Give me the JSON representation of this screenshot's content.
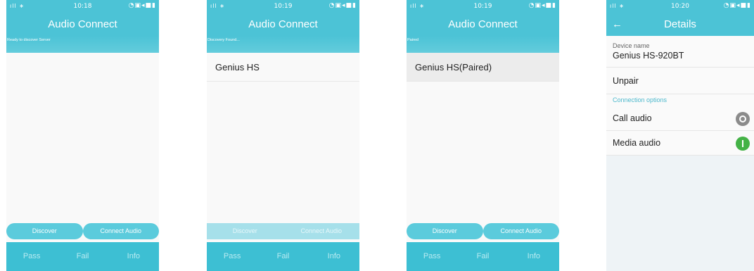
{
  "screens": [
    {
      "status": {
        "left": "ıll ∗",
        "time": "10:18",
        "right": "◔▣◂■▮"
      },
      "title": "Audio Connect",
      "subtitle": "Ready to discover Server",
      "items": [],
      "buttons": {
        "discover": "Discover",
        "connect": "Connect Audio"
      },
      "footer": {
        "pass": "Pass",
        "fail": "Fail",
        "info": "Info"
      }
    },
    {
      "status": {
        "left": "ıll ∗",
        "time": "10:19",
        "right": "◔▣◂■▮"
      },
      "title": "Audio Connect",
      "subtitle": "Discovery Found...",
      "items": [
        "Genius HS"
      ],
      "buttons": {
        "discover": "Discover",
        "connect": "Connect Audio"
      },
      "footer": {
        "pass": "Pass",
        "fail": "Fail",
        "info": "Info"
      }
    },
    {
      "status": {
        "left": "ıll ∗",
        "time": "10:19",
        "right": "◔▣◂■▮"
      },
      "title": "Audio Connect",
      "subtitle": "Paired",
      "items": [
        "Genius HS(Paired)"
      ],
      "buttons": {
        "discover": "Discover",
        "connect": "Connect Audio"
      },
      "footer": {
        "pass": "Pass",
        "fail": "Fail",
        "info": "Info"
      }
    }
  ],
  "details": {
    "status": {
      "left": "ıll ∗",
      "time": "10:20",
      "right": "◔▣◂■▮"
    },
    "back_icon": "←",
    "title": "Details",
    "device_name_label": "Device name",
    "device_name": "Genius HS-920BT",
    "unpair": "Unpair",
    "section": "Connection options",
    "call_audio": "Call audio",
    "call_audio_on": false,
    "media_audio": "Media audio",
    "media_audio_on": true
  },
  "colors": {
    "accent": "#4cc3d6",
    "toggle_on": "#44b246",
    "toggle_off": "#8b8b8b"
  }
}
